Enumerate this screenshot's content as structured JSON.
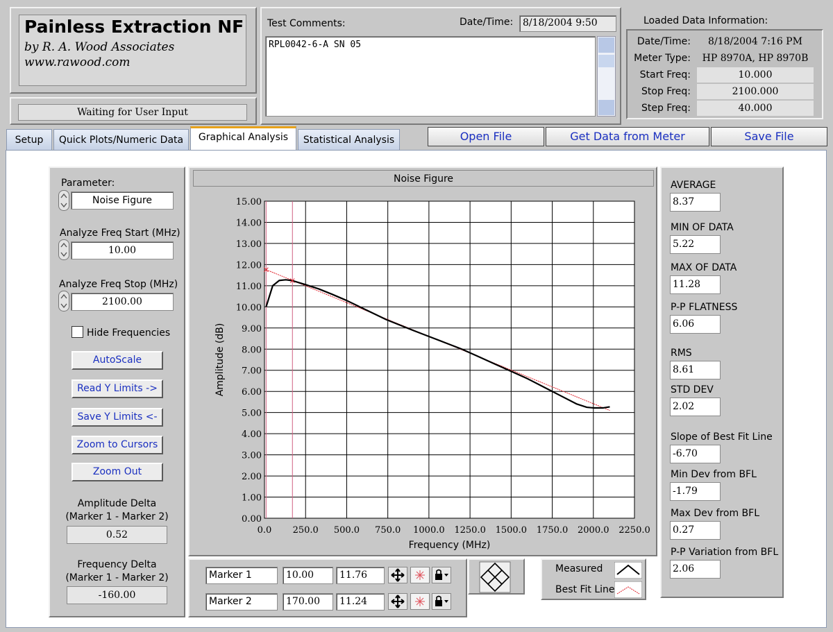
{
  "app": {
    "title": "Painless Extraction NF",
    "byline": "by R. A. Wood Associates",
    "url": "www.rawood.com",
    "status": "Waiting for User Input"
  },
  "test": {
    "comments_label": "Test Comments:",
    "comments": "RPL0042-6-A SN 05",
    "datetime_label": "Date/Time:",
    "datetime": "8/18/2004  9:50"
  },
  "loaded": {
    "title": "Loaded Data Information:",
    "rows": [
      {
        "label": "Date/Time:",
        "value": "8/18/2004  7:16 PM"
      },
      {
        "label": "Meter Type:",
        "value": "HP 8970A, HP 8970B"
      },
      {
        "label": "Start Freq:",
        "value": "10.000"
      },
      {
        "label": "Stop Freq:",
        "value": "2100.000"
      },
      {
        "label": "Step Freq:",
        "value": "40.000"
      }
    ]
  },
  "tabs": [
    "Setup",
    "Quick Plots/Numeric Data",
    "Graphical Analysis",
    "Statistical Analysis"
  ],
  "actions": {
    "open": "Open File",
    "get": "Get Data from Meter",
    "save": "Save File"
  },
  "left": {
    "parameter_label": "Parameter:",
    "parameter_value": "Noise Figure",
    "start_label": "Analyze Freq Start (MHz)",
    "start_value": "10.00",
    "stop_label": "Analyze Freq Stop (MHz)",
    "stop_value": "2100.00",
    "hide_freq_label": "Hide Frequencies",
    "buttons": {
      "autoscale": "AutoScale",
      "read": "Read Y Limits ->",
      "save": "Save Y Limits <-",
      "zoom_cursors": "Zoom to Cursors",
      "zoom_out": "Zoom Out"
    },
    "amp_delta_label1": "Amplitude Delta",
    "amp_delta_label2": "(Marker 1 - Marker 2)",
    "amp_delta_value": "0.52",
    "freq_delta_label1": "Frequency Delta",
    "freq_delta_label2": "(Marker 1 - Marker 2)",
    "freq_delta_value": "-160.00"
  },
  "markers": [
    {
      "name": "Marker 1",
      "freq": "10.00",
      "amp": "11.76"
    },
    {
      "name": "Marker 2",
      "freq": "170.00",
      "amp": "11.24"
    }
  ],
  "legend": {
    "measured": "Measured",
    "bfl": "Best Fit Line"
  },
  "stats": [
    {
      "label": "AVERAGE",
      "value": "8.37"
    },
    {
      "label": "MIN OF DATA",
      "value": "5.22"
    },
    {
      "label": "MAX OF DATA",
      "value": "11.28"
    },
    {
      "label": "P-P FLATNESS",
      "value": "6.06"
    },
    {
      "label": "RMS",
      "value": "8.61"
    },
    {
      "label": "STD DEV",
      "value": "2.02"
    },
    {
      "label": "Slope of Best Fit Line",
      "value": "-6.70"
    },
    {
      "label": "Min Dev from BFL",
      "value": "-1.79"
    },
    {
      "label": "Max Dev from BFL",
      "value": "0.27"
    },
    {
      "label": "P-P Variation from BFL",
      "value": "2.06"
    }
  ],
  "colors": {
    "measured": "#000000",
    "bfl": "#e0202a",
    "cursor": "#d06080",
    "accent": "#1a2fc0"
  },
  "chart_data": {
    "type": "line",
    "title": "Noise Figure",
    "xlabel": "Frequency (MHz)",
    "ylabel": "Amplitude (dB)",
    "xlim": [
      0,
      2250
    ],
    "ylim": [
      0,
      15
    ],
    "grid": true,
    "x_ticks": [
      "0.0",
      "250.0",
      "500.0",
      "750.0",
      "1000.0",
      "1250.0",
      "1500.0",
      "1750.0",
      "2000.0",
      "2250.0"
    ],
    "y_ticks": [
      "0.00",
      "1.00",
      "2.00",
      "3.00",
      "4.00",
      "5.00",
      "6.00",
      "7.00",
      "8.00",
      "9.00",
      "10.00",
      "11.00",
      "12.00",
      "13.00",
      "14.00",
      "15.00"
    ],
    "cursors": [
      10,
      170
    ],
    "series": [
      {
        "name": "Measured",
        "x": [
          10,
          50,
          90,
          130,
          170,
          250,
          330,
          410,
          500,
          580,
          660,
          740,
          820,
          900,
          1000,
          1100,
          1200,
          1300,
          1400,
          1500,
          1600,
          1700,
          1800,
          1900,
          1960,
          2000,
          2060,
          2100
        ],
        "y": [
          10.0,
          11.0,
          11.25,
          11.28,
          11.24,
          11.05,
          10.85,
          10.6,
          10.3,
          10.0,
          9.7,
          9.4,
          9.15,
          8.9,
          8.6,
          8.3,
          8.0,
          7.65,
          7.3,
          6.95,
          6.6,
          6.2,
          5.8,
          5.4,
          5.25,
          5.22,
          5.22,
          5.27
        ]
      },
      {
        "name": "Best Fit Line",
        "x": [
          10,
          2100
        ],
        "y": [
          11.76,
          5.1
        ]
      }
    ]
  }
}
